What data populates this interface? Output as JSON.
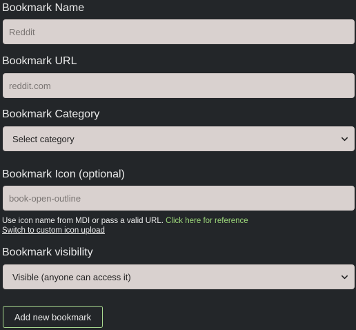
{
  "form": {
    "name": {
      "label": "Bookmark Name",
      "placeholder": "Reddit",
      "value": ""
    },
    "url": {
      "label": "Bookmark URL",
      "placeholder": "reddit.com",
      "value": ""
    },
    "category": {
      "label": "Bookmark Category",
      "selected": "Select category"
    },
    "icon": {
      "label": "Bookmark Icon (optional)",
      "placeholder": "book-open-outline",
      "value": "",
      "help_text": "Use icon name from MDI or pass a valid URL.",
      "help_link": "Click here for reference",
      "switch_link": "Switch to custom icon upload"
    },
    "visibility": {
      "label": "Bookmark visibility",
      "selected": "Visible (anyone can access it)"
    },
    "submit_label": "Add new bookmark"
  },
  "colors": {
    "background": "#232629",
    "field_background": "#d9d1cf",
    "link_green": "#9cd67a",
    "button_border": "#a8d98f"
  }
}
